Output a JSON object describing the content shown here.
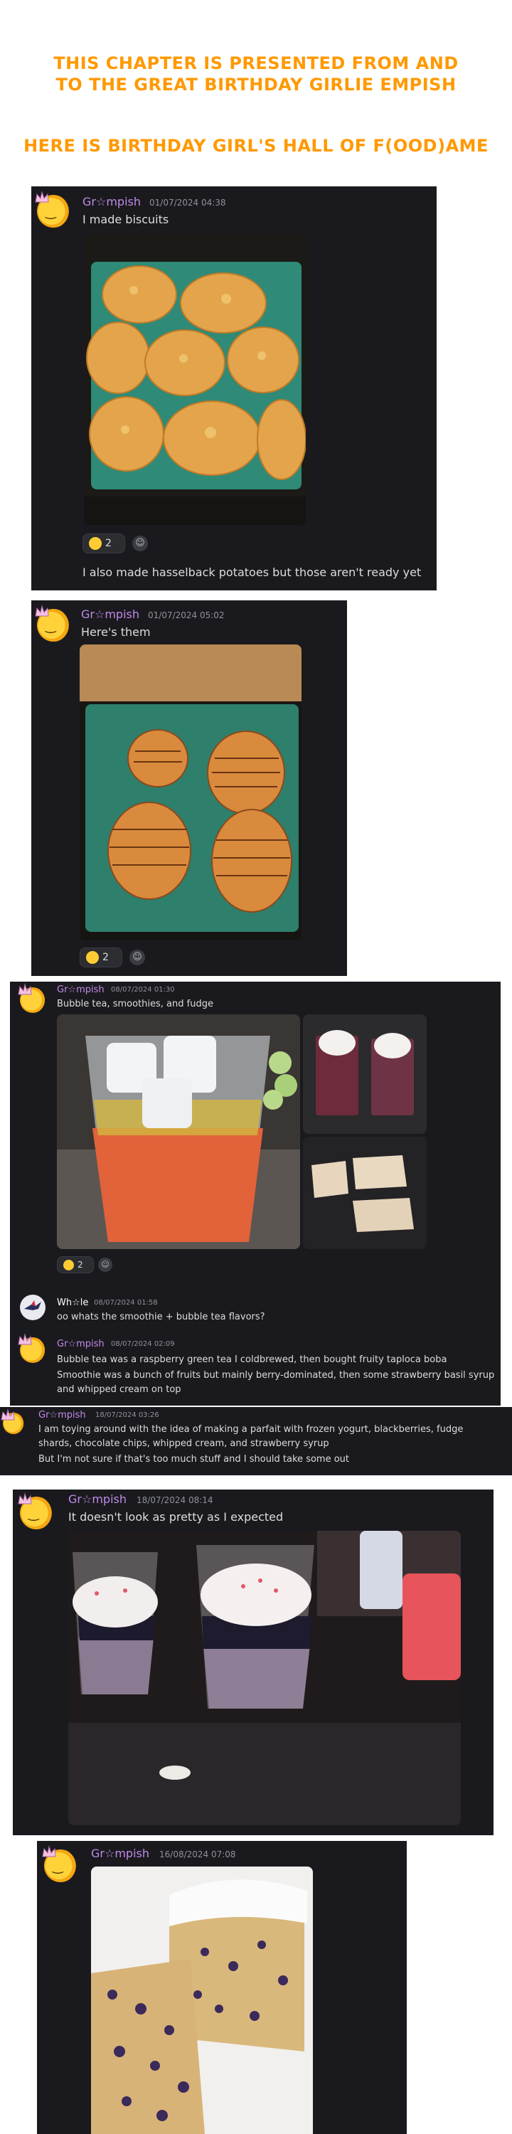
{
  "headings": {
    "line1": "This chapter is presented from and",
    "line2": "to the great birthday girlie Empish",
    "line3": "Here is birthday girl's hall of F(ood)ame"
  },
  "posts": {
    "p1": {
      "username": "Gr☆mpish",
      "timestamp": "01/07/2024 04:38",
      "text": "I made biscuits",
      "reaction_count": "2",
      "followup": "I also made hasselback potatoes but those aren't ready yet"
    },
    "p2": {
      "username": "Gr☆mpish",
      "timestamp": "01/07/2024 05:02",
      "text": "Here's them",
      "reaction_count": "2"
    },
    "p3": {
      "username": "Gr☆mpish",
      "timestamp": "08/07/2024 01:30",
      "text": "Bubble tea, smoothies, and fudge",
      "reaction_count": "2"
    },
    "p4": {
      "username": "Wh☆le",
      "timestamp": "08/07/2024 01:58",
      "text": "oo whats the smoothie + bubble tea flavors?"
    },
    "p5": {
      "username": "Gr☆mpish",
      "timestamp": "08/07/2024 02:09",
      "line1": "Bubble tea was a raspberry green tea I coldbrewed, then bought fruity taploca boba",
      "line2": "Smoothie was a bunch of fruits but mainly berry-dominated, then some strawberry basil syrup",
      "line3": "and whipped cream on top"
    },
    "p6": {
      "username": "Gr☆mpish",
      "timestamp": "18/07/2024 03:26",
      "line1": "I am toying around with the idea of making a parfait with frozen yogurt, blackberries, fudge",
      "line2": "shards, chocolate chips, whipped cream, and strawberry syrup",
      "line3": "But I'm not sure if that's too much stuff and I should take some out"
    },
    "p7": {
      "username": "Gr☆mpish",
      "timestamp": "18/07/2024 08:14",
      "text": "It doesn't look as pretty as I expected"
    },
    "p8": {
      "username": "Gr☆mpish",
      "timestamp": "16/08/2024 07:08"
    }
  },
  "icons": {
    "avatar": "crowned-smiley-avatar",
    "avatar_bird": "bird-avatar",
    "reaction": "grinning-emoji",
    "reaction_surprised": "surprised-emoji",
    "add_reaction": "add-reaction-icon"
  },
  "colors": {
    "heading": "#ff9900",
    "card_bg": "#1a1a1e",
    "username": "#c08ae8"
  }
}
